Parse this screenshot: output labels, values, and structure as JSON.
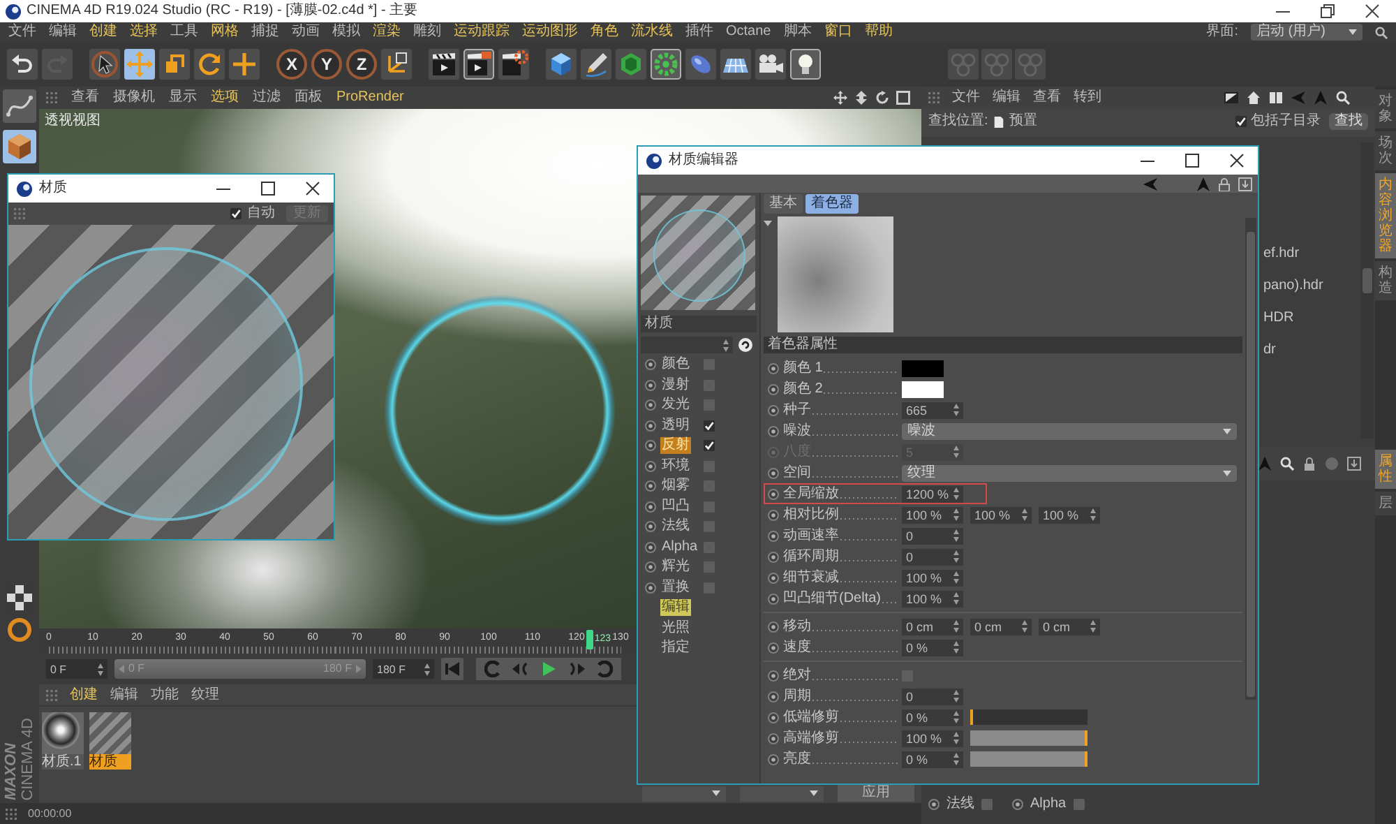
{
  "window": {
    "title": "CINEMA 4D R19.024 Studio (RC - R19) - [薄膜-02.c4d *] - 主要"
  },
  "menu_bar": {
    "items": [
      {
        "label": "文件",
        "highlighted": false
      },
      {
        "label": "编辑",
        "highlighted": false
      },
      {
        "label": "创建",
        "highlighted": true
      },
      {
        "label": "选择",
        "highlighted": true
      },
      {
        "label": "工具",
        "highlighted": false
      },
      {
        "label": "网格",
        "highlighted": true
      },
      {
        "label": "捕捉",
        "highlighted": false
      },
      {
        "label": "动画",
        "highlighted": false
      },
      {
        "label": "模拟",
        "highlighted": false
      },
      {
        "label": "渲染",
        "highlighted": true
      },
      {
        "label": "雕刻",
        "highlighted": false
      },
      {
        "label": "运动跟踪",
        "highlighted": true
      },
      {
        "label": "运动图形",
        "highlighted": true
      },
      {
        "label": "角色",
        "highlighted": true
      },
      {
        "label": "流水线",
        "highlighted": true
      },
      {
        "label": "插件",
        "highlighted": false
      },
      {
        "label": "Octane",
        "highlighted": false
      },
      {
        "label": "脚本",
        "highlighted": false
      },
      {
        "label": "窗口",
        "highlighted": true
      },
      {
        "label": "帮助",
        "highlighted": true
      }
    ],
    "layout_label": "界面:",
    "layout_value": "启动 (用户)"
  },
  "toolbar": {
    "tools": [
      {
        "selected": false
      },
      {
        "selected": true
      },
      {
        "selected": false
      },
      {
        "selected": false
      },
      {
        "selected": false
      }
    ],
    "axes": [
      {
        "label": "X"
      },
      {
        "label": "Y"
      },
      {
        "label": "Z"
      }
    ]
  },
  "left_toolbar": {
    "tools": [
      {
        "selected": false
      },
      {
        "selected": true
      }
    ]
  },
  "viewport": {
    "menu": [
      {
        "label": "查看",
        "highlighted": false
      },
      {
        "label": "摄像机",
        "highlighted": false
      },
      {
        "label": "显示",
        "highlighted": false
      },
      {
        "label": "选项",
        "highlighted": true
      },
      {
        "label": "过滤",
        "highlighted": false
      },
      {
        "label": "面板",
        "highlighted": false
      },
      {
        "label": "ProRender",
        "highlighted": true
      }
    ],
    "view_name": "透视视图"
  },
  "timeline": {
    "ruler": [
      "0",
      "10",
      "20",
      "30",
      "40",
      "50",
      "60",
      "70",
      "80",
      "90",
      "100",
      "110",
      "120",
      "130"
    ],
    "playhead": {
      "label": "123",
      "level": 0.946
    },
    "start_field": "0 F",
    "range": {
      "start": "0 F",
      "end": "180 F",
      "level": 1
    },
    "end_field": "180 F"
  },
  "material_manager": {
    "menu": [
      {
        "label": "创建",
        "highlighted": true
      },
      {
        "label": "编辑",
        "highlighted": false
      },
      {
        "label": "功能",
        "highlighted": false
      },
      {
        "label": "纹理",
        "highlighted": false
      }
    ],
    "materials": [
      {
        "name": "材质.1",
        "kind": "chrome",
        "selected": false
      },
      {
        "name": "材质",
        "kind": "striped",
        "selected": true
      }
    ],
    "apply_button": "应用"
  },
  "status_bar": {
    "time": "00:00:00"
  },
  "logo": {
    "brand": "MAXON",
    "product": "CINEMA 4D"
  },
  "content_browser": {
    "menu": [
      "文件",
      "编辑",
      "查看",
      "转到"
    ],
    "search_label": "查找位置:",
    "search_location": "预置",
    "include_subfolders": {
      "label": "包括子目录",
      "checked": true
    },
    "search_button": "查找",
    "files": [
      "ef.hdr",
      "pano).hdr",
      "HDR",
      "dr"
    ]
  },
  "right_tabs": {
    "top": [
      {
        "label": "对象",
        "selected": false
      },
      {
        "label": "场次",
        "selected": false
      },
      {
        "label": "内容浏览器",
        "selected": true
      },
      {
        "label": "构造",
        "selected": false
      }
    ],
    "bottom": [
      {
        "label": "属性",
        "selected": true
      },
      {
        "label": "层",
        "selected": false
      }
    ]
  },
  "attribute_manager": {
    "channels": [
      {
        "label": "法线",
        "checked": false
      },
      {
        "label": "Alpha",
        "checked": false
      }
    ]
  },
  "preview_window": {
    "title": "材质",
    "auto": {
      "label": "自动",
      "checked": true
    },
    "update_button": {
      "label": "更新",
      "disabled": true
    }
  },
  "material_editor": {
    "title": "材质编辑器",
    "material_name": "材质",
    "channels": [
      {
        "label": "颜色",
        "checked": false,
        "selected": false
      },
      {
        "label": "漫射",
        "checked": false,
        "selected": false
      },
      {
        "label": "发光",
        "checked": false,
        "selected": false
      },
      {
        "label": "透明",
        "checked": true,
        "selected": false
      },
      {
        "label": "反射",
        "checked": true,
        "selected": true
      },
      {
        "label": "环境",
        "checked": false,
        "selected": false
      },
      {
        "label": "烟雾",
        "checked": false,
        "selected": false
      },
      {
        "label": "凹凸",
        "checked": false,
        "selected": false
      },
      {
        "label": "法线",
        "checked": false,
        "selected": false
      },
      {
        "label": "Alpha",
        "checked": false,
        "selected": false
      },
      {
        "label": "辉光",
        "checked": false,
        "selected": false
      },
      {
        "label": "置换",
        "checked": false,
        "selected": false
      }
    ],
    "pages": [
      {
        "label": "编辑",
        "selected": true
      },
      {
        "label": "光照",
        "selected": false
      },
      {
        "label": "指定",
        "selected": false
      }
    ],
    "tabs": [
      {
        "label": "基本",
        "selected": false
      },
      {
        "label": "着色器",
        "selected": true
      }
    ],
    "section_title": "着色器属性",
    "param_groups": [
      [
        {
          "kind": "color",
          "label": "颜色 1",
          "color": "#000000",
          "disabled": false,
          "highlighted": false
        },
        {
          "kind": "color",
          "label": "颜色 2",
          "color": "#ffffff",
          "disabled": false,
          "highlighted": false
        },
        {
          "kind": "number",
          "label": "种子",
          "values": [
            "665"
          ],
          "disabled": false,
          "highlighted": false
        },
        {
          "kind": "dropdown",
          "label": "噪波",
          "value": "噪波",
          "disabled": false,
          "highlighted": false
        },
        {
          "kind": "number",
          "label": "八度",
          "values": [
            "5"
          ],
          "disabled": true,
          "highlighted": false
        },
        {
          "kind": "dropdown",
          "label": "空间",
          "value": "纹理",
          "disabled": false,
          "highlighted": false
        },
        {
          "kind": "number",
          "label": "全局缩放",
          "values": [
            "1200 %"
          ],
          "disabled": false,
          "highlighted": true
        },
        {
          "kind": "number",
          "label": "相对比例",
          "values": [
            "100 %",
            "100 %",
            "100 %"
          ],
          "disabled": false,
          "highlighted": false
        },
        {
          "kind": "number",
          "label": "动画速率",
          "values": [
            "0"
          ],
          "disabled": false,
          "highlighted": false
        },
        {
          "kind": "number",
          "label": "循环周期",
          "values": [
            "0"
          ],
          "disabled": false,
          "highlighted": false
        },
        {
          "kind": "number",
          "label": "细节衰减",
          "values": [
            "100 %"
          ],
          "disabled": false,
          "highlighted": false
        },
        {
          "kind": "number",
          "label": "凹凸细节(Delta)",
          "values": [
            "100 %"
          ],
          "disabled": false,
          "highlighted": false
        }
      ],
      [
        {
          "kind": "number",
          "label": "移动",
          "values": [
            "0 cm",
            "0 cm",
            "0 cm"
          ],
          "disabled": false,
          "highlighted": false
        },
        {
          "kind": "number",
          "label": "速度",
          "values": [
            "0 %"
          ],
          "disabled": false,
          "highlighted": false
        }
      ],
      [
        {
          "kind": "checkbox",
          "label": "绝对",
          "checked": false,
          "disabled": false,
          "highlighted": false
        },
        {
          "kind": "number",
          "label": "周期",
          "values": [
            "0"
          ],
          "disabled": false,
          "highlighted": false
        },
        {
          "kind": "slider",
          "label": "低端修剪",
          "values": [
            "0 %"
          ],
          "level": 0,
          "disabled": false,
          "highlighted": false
        },
        {
          "kind": "slider",
          "label": "高端修剪",
          "values": [
            "100 %"
          ],
          "level": 1,
          "disabled": false,
          "highlighted": false
        },
        {
          "kind": "slider",
          "label": "亮度",
          "values": [
            "0 %"
          ],
          "level": 1,
          "disabled": false,
          "highlighted": false
        }
      ]
    ]
  }
}
